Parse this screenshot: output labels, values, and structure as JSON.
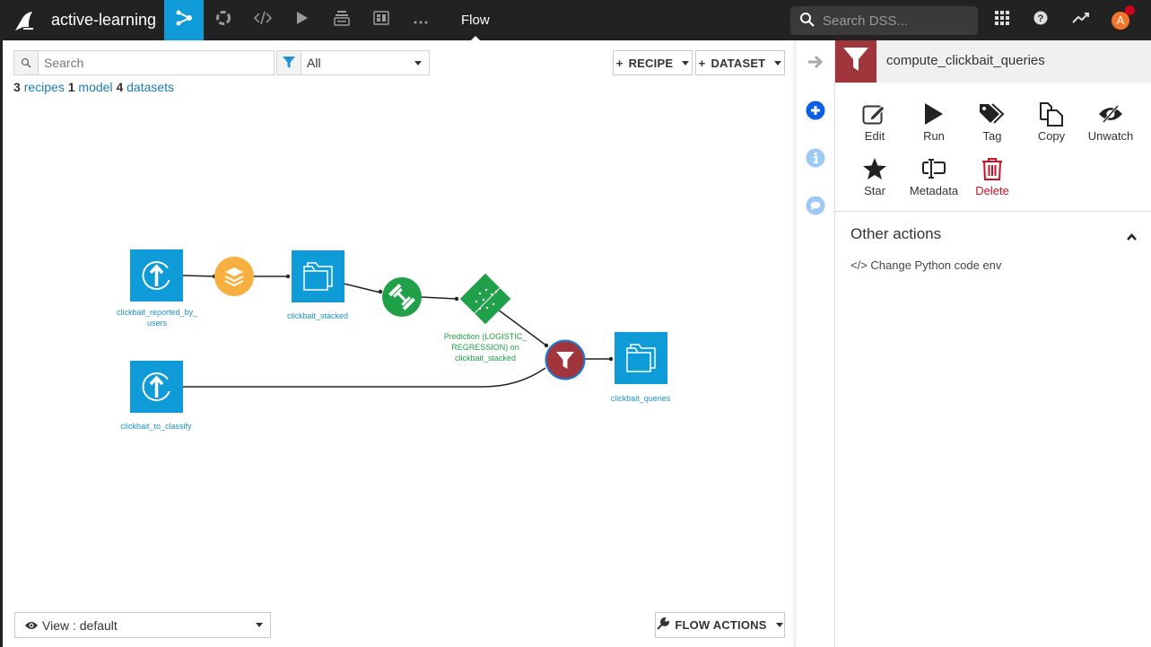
{
  "topbar": {
    "project_name": "active-learning",
    "nav_items": [
      {
        "name": "flow-icon",
        "active": true
      },
      {
        "name": "ml-icon",
        "active": false
      },
      {
        "name": "code-icon",
        "active": false
      },
      {
        "name": "run-icon",
        "active": false
      },
      {
        "name": "deploy-icon",
        "active": false
      },
      {
        "name": "dashboard-icon",
        "active": false
      },
      {
        "name": "more-icon",
        "active": false
      }
    ],
    "current_section": "Flow",
    "search_placeholder": "Search DSS...",
    "avatar_initial": "A",
    "notification_color": "#d0011b",
    "active_color": "#0f9bd7"
  },
  "canvas": {
    "search_placeholder": "Search",
    "filter_value": "All",
    "counts": {
      "recipes_count": "3",
      "recipes_label": "recipes",
      "models_count": "1",
      "models_label": "model",
      "datasets_count": "4",
      "datasets_label": "datasets"
    },
    "recipe_button": "RECIPE",
    "dataset_button": "DATASET",
    "view_label": "View : default",
    "flow_actions_label": "FLOW ACTIONS",
    "nodes": {
      "clickbait_reported_by_users": "clickbait_reported_by_",
      "clickbait_reported_by_users_2": "users",
      "clickbait_stacked": "clickbait_stacked",
      "prediction_line1": "Prediction (LOGISTIC_",
      "prediction_line2": "REGRESSION) on",
      "prediction_line3": "clickbait_stacked",
      "clickbait_to_classify": "clickbait_to_classify",
      "clickbait_queries": "clickbait_queries"
    },
    "colors": {
      "dataset": "#0f9bd7",
      "stack_recipe": "#f7b03f",
      "model": "#21a04a",
      "filter_recipe": "#a0353b"
    }
  },
  "right_panel": {
    "title": "compute_clickbait_queries",
    "actions": [
      {
        "label": "Edit"
      },
      {
        "label": "Run"
      },
      {
        "label": "Tag"
      },
      {
        "label": "Copy"
      },
      {
        "label": "Unwatch"
      },
      {
        "label": "Star"
      },
      {
        "label": "Metadata"
      },
      {
        "label": "Delete"
      }
    ],
    "other_actions_title": "Other actions",
    "other_actions_items": [
      "</> Change Python code env"
    ]
  }
}
